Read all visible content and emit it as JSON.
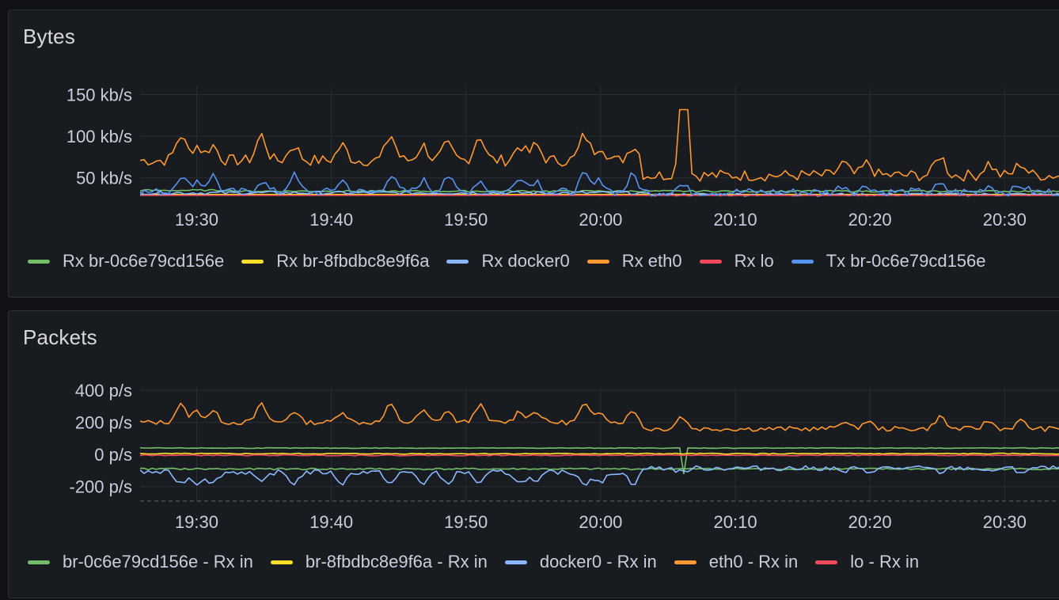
{
  "panels": [
    {
      "title": "Bytes",
      "chart_data": {
        "type": "line",
        "ylim": [
          25,
          160
        ],
        "yticks": [
          {
            "value": 150,
            "label": "150 kb/s"
          },
          {
            "value": 100,
            "label": "100 kb/s"
          },
          {
            "value": 50,
            "label": "50 kb/s"
          }
        ],
        "xlim": [
          19.43,
          20.58
        ],
        "xticks": [
          {
            "value": 19.5,
            "label": "19:30"
          },
          {
            "value": 19.6667,
            "label": "19:40"
          },
          {
            "value": 19.8333,
            "label": "19:50"
          },
          {
            "value": 20.0,
            "label": "20:00"
          },
          {
            "value": 20.1667,
            "label": "20:10"
          },
          {
            "value": 20.3333,
            "label": "20:20"
          },
          {
            "value": 20.5,
            "label": "20:30"
          }
        ],
        "grid": true,
        "series": [
          {
            "name": "Rx br-0c6e79cd156e",
            "color": "#73bf69",
            "values": []
          },
          {
            "name": "Rx br-8fbdbc8e9f6a",
            "color": "#fade2a",
            "values": []
          },
          {
            "name": "Rx docker0",
            "color": "#8ab8ff",
            "values": []
          },
          {
            "name": "Rx eth0",
            "color": "#ff9830",
            "values": []
          },
          {
            "name": "Rx lo",
            "color": "#f2495c",
            "values": []
          },
          {
            "name": "Tx br-0c6e79cd156e",
            "color": "#5794f2",
            "values": []
          }
        ]
      }
    },
    {
      "title": "Packets",
      "chart_data": {
        "type": "line",
        "ylim": [
          -290,
          420
        ],
        "yticks": [
          {
            "value": 400,
            "label": "400 p/s"
          },
          {
            "value": 200,
            "label": "200 p/s"
          },
          {
            "value": 0,
            "label": "0 p/s"
          },
          {
            "value": -200,
            "label": "-200 p/s"
          }
        ],
        "xlim": [
          19.43,
          20.58
        ],
        "xticks": [
          {
            "value": 19.5,
            "label": "19:30"
          },
          {
            "value": 19.6667,
            "label": "19:40"
          },
          {
            "value": 19.8333,
            "label": "19:50"
          },
          {
            "value": 20.0,
            "label": "20:00"
          },
          {
            "value": 20.1667,
            "label": "20:10"
          },
          {
            "value": 20.3333,
            "label": "20:20"
          },
          {
            "value": 20.5,
            "label": "20:30"
          }
        ],
        "grid": true,
        "series": [
          {
            "name": "br-0c6e79cd156e - Rx in",
            "color": "#73bf69",
            "values": []
          },
          {
            "name": "br-8fbdbc8e9f6a - Rx in",
            "color": "#fade2a",
            "values": []
          },
          {
            "name": "docker0 - Rx in",
            "color": "#8ab8ff",
            "values": []
          },
          {
            "name": "eth0 - Rx in",
            "color": "#ff9830",
            "values": []
          },
          {
            "name": "lo - Rx in",
            "color": "#f2495c",
            "values": []
          }
        ]
      }
    }
  ]
}
